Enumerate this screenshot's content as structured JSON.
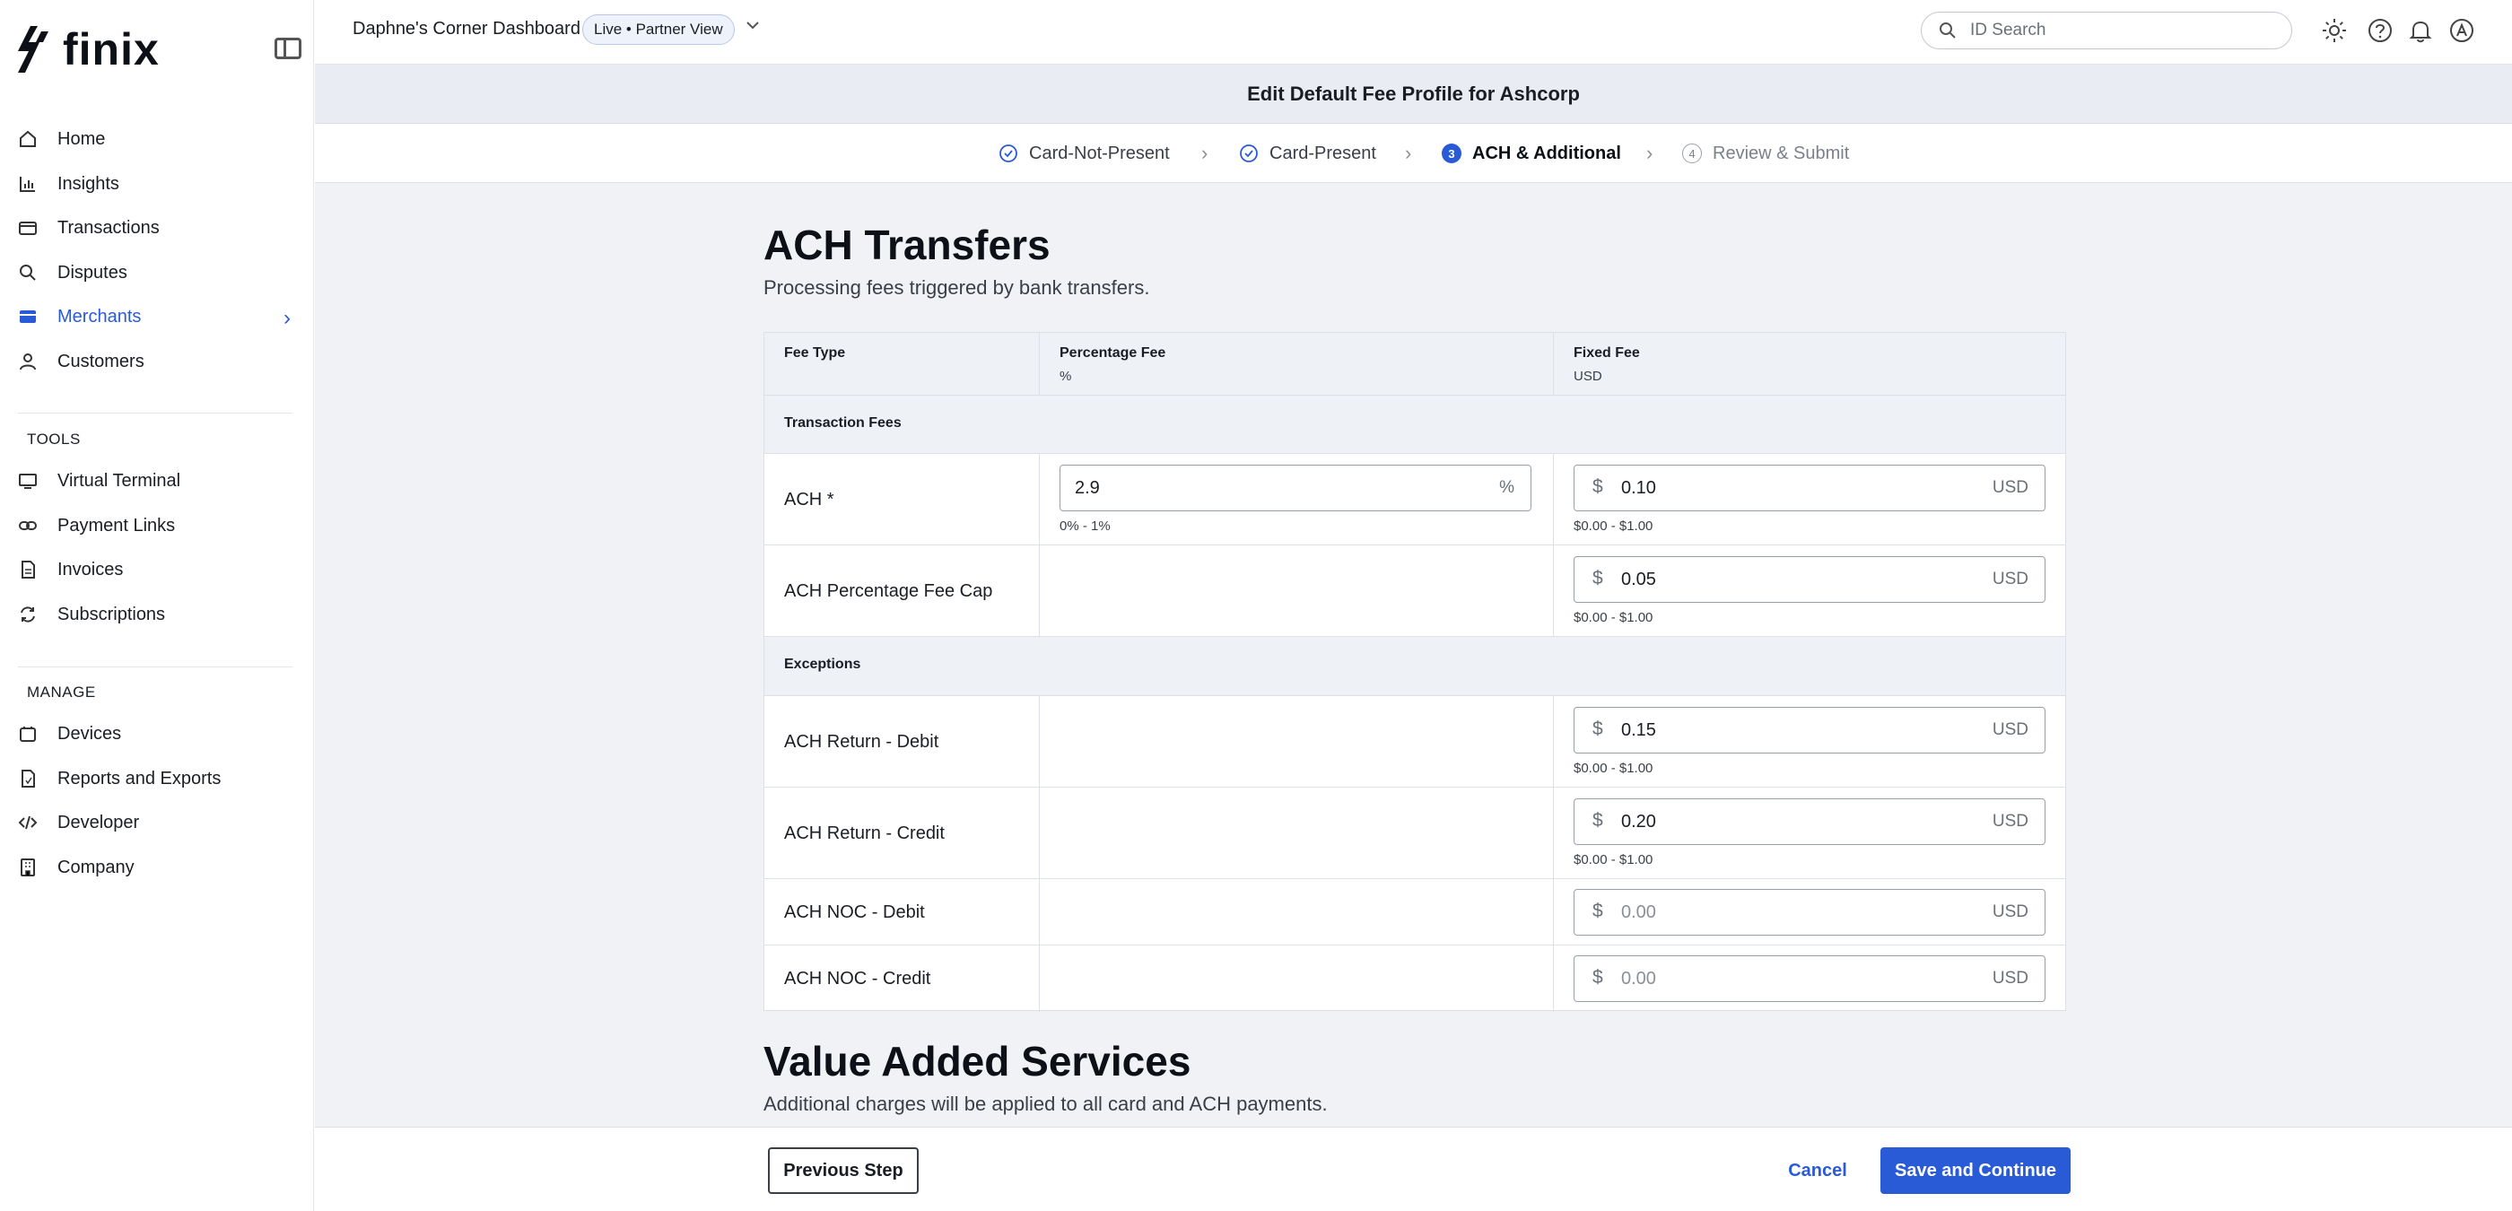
{
  "brand": {
    "name": "finix",
    "accent": "#2a5bd7"
  },
  "sidebar": {
    "items": [
      {
        "label": "Home",
        "icon": "home-icon"
      },
      {
        "label": "Insights",
        "icon": "bar-chart-icon"
      },
      {
        "label": "Transactions",
        "icon": "card-icon"
      },
      {
        "label": "Disputes",
        "icon": "magnify-icon"
      },
      {
        "label": "Merchants",
        "icon": "store-icon",
        "active": true
      },
      {
        "label": "Customers",
        "icon": "user-icon"
      }
    ],
    "tools_heading": "TOOLS",
    "tools": [
      {
        "label": "Virtual Terminal",
        "icon": "terminal-icon"
      },
      {
        "label": "Payment Links",
        "icon": "link-icon"
      },
      {
        "label": "Invoices",
        "icon": "invoice-icon"
      },
      {
        "label": "Subscriptions",
        "icon": "refresh-icon"
      }
    ],
    "manage_heading": "MANAGE",
    "manage": [
      {
        "label": "Devices",
        "icon": "device-icon"
      },
      {
        "label": "Reports and Exports",
        "icon": "report-icon"
      },
      {
        "label": "Developer",
        "icon": "code-icon"
      },
      {
        "label": "Company",
        "icon": "building-icon"
      }
    ]
  },
  "topbar": {
    "dashboard_title": "Daphne's Corner Dashboard",
    "badge": "Live • Partner View",
    "search_placeholder": "ID Search"
  },
  "page": {
    "header": "Edit Default Fee Profile for Ashcorp",
    "steps": [
      {
        "label": "Card-Not-Present",
        "status": "done"
      },
      {
        "label": "Card-Present",
        "status": "done"
      },
      {
        "label": "ACH & Additional",
        "status": "current",
        "num": "3"
      },
      {
        "label": "Review & Submit",
        "status": "todo",
        "num": "4"
      }
    ]
  },
  "ach": {
    "title": "ACH Transfers",
    "subtitle": "Processing fees triggered by bank transfers.",
    "columns": {
      "fee_type": "Fee Type",
      "percentage": "Percentage Fee",
      "percentage_unit": "%",
      "fixed": "Fixed Fee",
      "fixed_unit": "USD"
    },
    "group_transaction": "Transaction Fees",
    "group_exceptions": "Exceptions",
    "rows": [
      {
        "label": "ACH *",
        "pct_value": "2.9",
        "pct_suffix": "%",
        "pct_hint": "0% - 1%",
        "currency": "$",
        "fixed_value": "0.10",
        "fixed_suffix": "USD",
        "fixed_hint": "$0.00 - $1.00"
      },
      {
        "label": "ACH Percentage Fee Cap",
        "currency": "$",
        "fixed_value": "0.05",
        "fixed_suffix": "USD",
        "fixed_hint": "$0.00 - $1.00"
      },
      {
        "label": "ACH Return - Debit",
        "currency": "$",
        "fixed_value": "0.15",
        "fixed_suffix": "USD",
        "fixed_hint": "$0.00 - $1.00"
      },
      {
        "label": "ACH Return - Credit",
        "currency": "$",
        "fixed_value": "0.20",
        "fixed_suffix": "USD",
        "fixed_hint": "$0.00 - $1.00"
      },
      {
        "label": "ACH NOC - Debit",
        "currency": "$",
        "fixed_placeholder": "0.00",
        "fixed_suffix": "USD"
      },
      {
        "label": "ACH NOC - Credit",
        "currency": "$",
        "fixed_placeholder": "0.00",
        "fixed_suffix": "USD"
      }
    ]
  },
  "vas": {
    "title": "Value Added Services",
    "subtitle": "Additional charges will be applied to all card and ACH payments."
  },
  "footer": {
    "prev_label": "Previous Step",
    "cancel_label": "Cancel",
    "save_label": "Save and Continue"
  }
}
